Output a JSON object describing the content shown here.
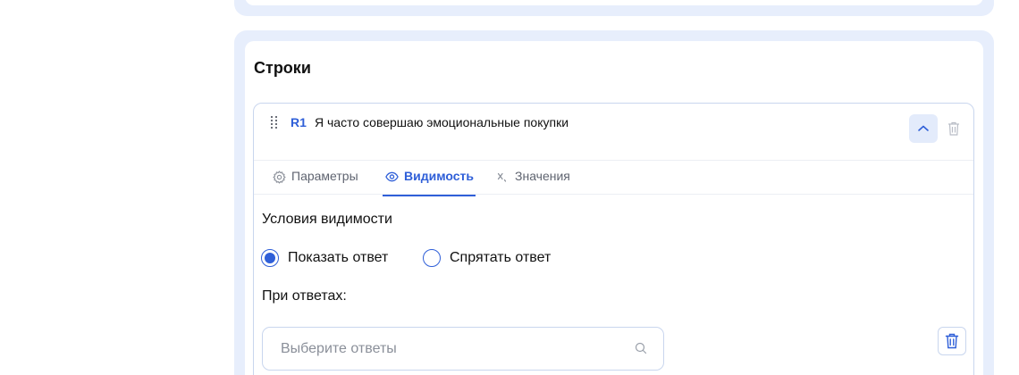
{
  "section": {
    "title": "Строки"
  },
  "row": {
    "code": "R1",
    "text": "Я часто совершаю эмоциональные покупки"
  },
  "tabs": [
    {
      "label": "Параметры",
      "icon": "gear-icon",
      "active": false
    },
    {
      "label": "Видимость",
      "icon": "eye-icon",
      "active": true
    },
    {
      "label": "Значения",
      "icon": "variable-icon",
      "active": false
    }
  ],
  "visibility": {
    "title": "Условия видимости",
    "options": [
      {
        "label": "Показать ответ",
        "selected": true
      },
      {
        "label": "Спрятать ответ",
        "selected": false
      }
    ],
    "answers_label": "При ответах:",
    "answers_placeholder": "Выберите ответы"
  },
  "colors": {
    "accent": "#2f5fd8",
    "section_bg": "#e7eefc",
    "border": "#c9d6ee"
  }
}
